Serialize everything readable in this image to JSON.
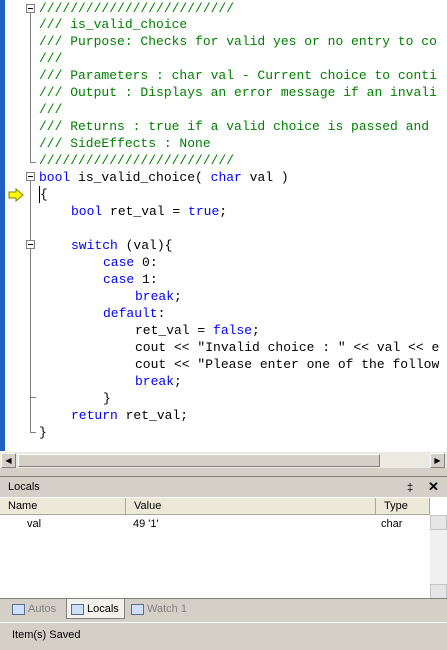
{
  "editor": {
    "lines": [
      {
        "cls": "comment",
        "text": "/////////////////////////"
      },
      {
        "cls": "comment",
        "text": "/// is_valid_choice"
      },
      {
        "cls": "comment",
        "text": "/// Purpose: Checks for valid yes or no entry to co"
      },
      {
        "cls": "comment",
        "text": "///"
      },
      {
        "cls": "comment",
        "text": "/// Parameters : char val - Current choice to conti"
      },
      {
        "cls": "comment",
        "text": "/// Output : Displays an error message if an invali"
      },
      {
        "cls": "comment",
        "text": "///"
      },
      {
        "cls": "comment",
        "text": "/// Returns : true if a valid choice is passed and"
      },
      {
        "cls": "comment",
        "text": "/// SideEffects : None"
      },
      {
        "cls": "comment",
        "text": "/////////////////////////"
      }
    ],
    "sig_kw1": "bool",
    "sig_name": " is_valid_choice( ",
    "sig_kw2": "char",
    "sig_rest": " val )",
    "open_brace": "{",
    "decl_kw": "bool",
    "decl_mid": " ret_val = ",
    "decl_val": "true",
    "decl_end": ";",
    "switch_kw": "switch",
    "switch_rest": " (val){",
    "case0_kw": "case",
    "case0_rest": " 0:",
    "case1_kw": "case",
    "case1_rest": " 1:",
    "break1": "break",
    "break1_end": ";",
    "default_kw": "default",
    "default_end": ":",
    "assign_mid": "ret_val = ",
    "assign_val": "false",
    "assign_end": ";",
    "cout1": "cout << \"Invalid choice : \" << val << e",
    "cout2": "cout << \"Please enter one of the follow",
    "break2": "break",
    "break2_end": ";",
    "close_switch": "}",
    "return_kw": "return",
    "return_rest": " ret_val;",
    "close_brace": "}"
  },
  "locals_panel": {
    "title": "Locals",
    "pin_glyph": "‡",
    "close_glyph": "✕",
    "columns": [
      "Name",
      "Value",
      "Type"
    ],
    "rows": [
      {
        "name": "val",
        "value": "49 '1'",
        "type": "char"
      }
    ]
  },
  "tabs": [
    {
      "label": "Autos",
      "icon": "autos-icon",
      "active": false
    },
    {
      "label": "Locals",
      "icon": "locals-icon",
      "active": true
    },
    {
      "label": "Watch 1",
      "icon": "watch-icon",
      "active": false
    }
  ],
  "status": {
    "text": "Item(s) Saved"
  },
  "colors": {
    "comment": "#008000",
    "keyword": "#0000ff",
    "margin": "#1f5fbf"
  }
}
